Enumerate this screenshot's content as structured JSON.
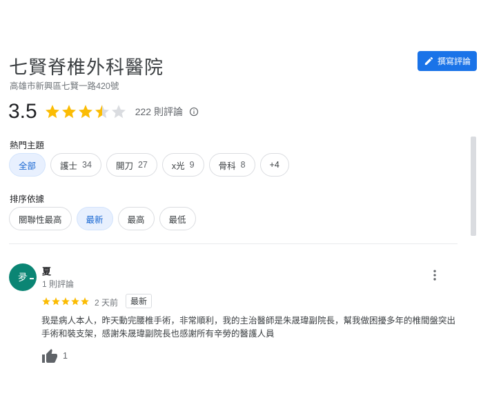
{
  "place": {
    "name": "七賢脊椎外科醫院",
    "address": "高雄市新興區七賢一路420號"
  },
  "write_review_label": "撰寫評論",
  "rating": {
    "score": "3.5",
    "stars_value": 3.5,
    "max_stars": 5,
    "review_count": "222 則評論",
    "star_color": "#fbbc04",
    "empty_star_color": "#dadce0"
  },
  "topics": {
    "label": "熱門主題",
    "chips": [
      {
        "label": "全部",
        "count": "",
        "active": true
      },
      {
        "label": "護士",
        "count": "34",
        "active": false
      },
      {
        "label": "開刀",
        "count": "27",
        "active": false
      },
      {
        "label": "x光",
        "count": "9",
        "active": false
      },
      {
        "label": "骨科",
        "count": "8",
        "active": false
      },
      {
        "label": "+4",
        "count": "",
        "active": false
      }
    ]
  },
  "sort": {
    "label": "排序依據",
    "chips": [
      {
        "label": "關聯性最高",
        "active": false
      },
      {
        "label": "最新",
        "active": true
      },
      {
        "label": "最高",
        "active": false
      },
      {
        "label": "最低",
        "active": false
      }
    ]
  },
  "review": {
    "avatar_text": "夛",
    "avatar_color": "#0b8574",
    "author": "夏",
    "author_meta": "1 則評論",
    "stars": 5,
    "date": "2 天前",
    "badge": "最新",
    "text": "我是病人本人，昨天動完腰椎手術，非常順利，我的主治醫師是朱晟瑋副院長，幫我做困擾多年的椎間盤突出手術和裝支架，感謝朱晟瑋副院長也感謝所有辛勞的醫護人員",
    "likes": "1"
  },
  "accent_color": "#1a73e8"
}
